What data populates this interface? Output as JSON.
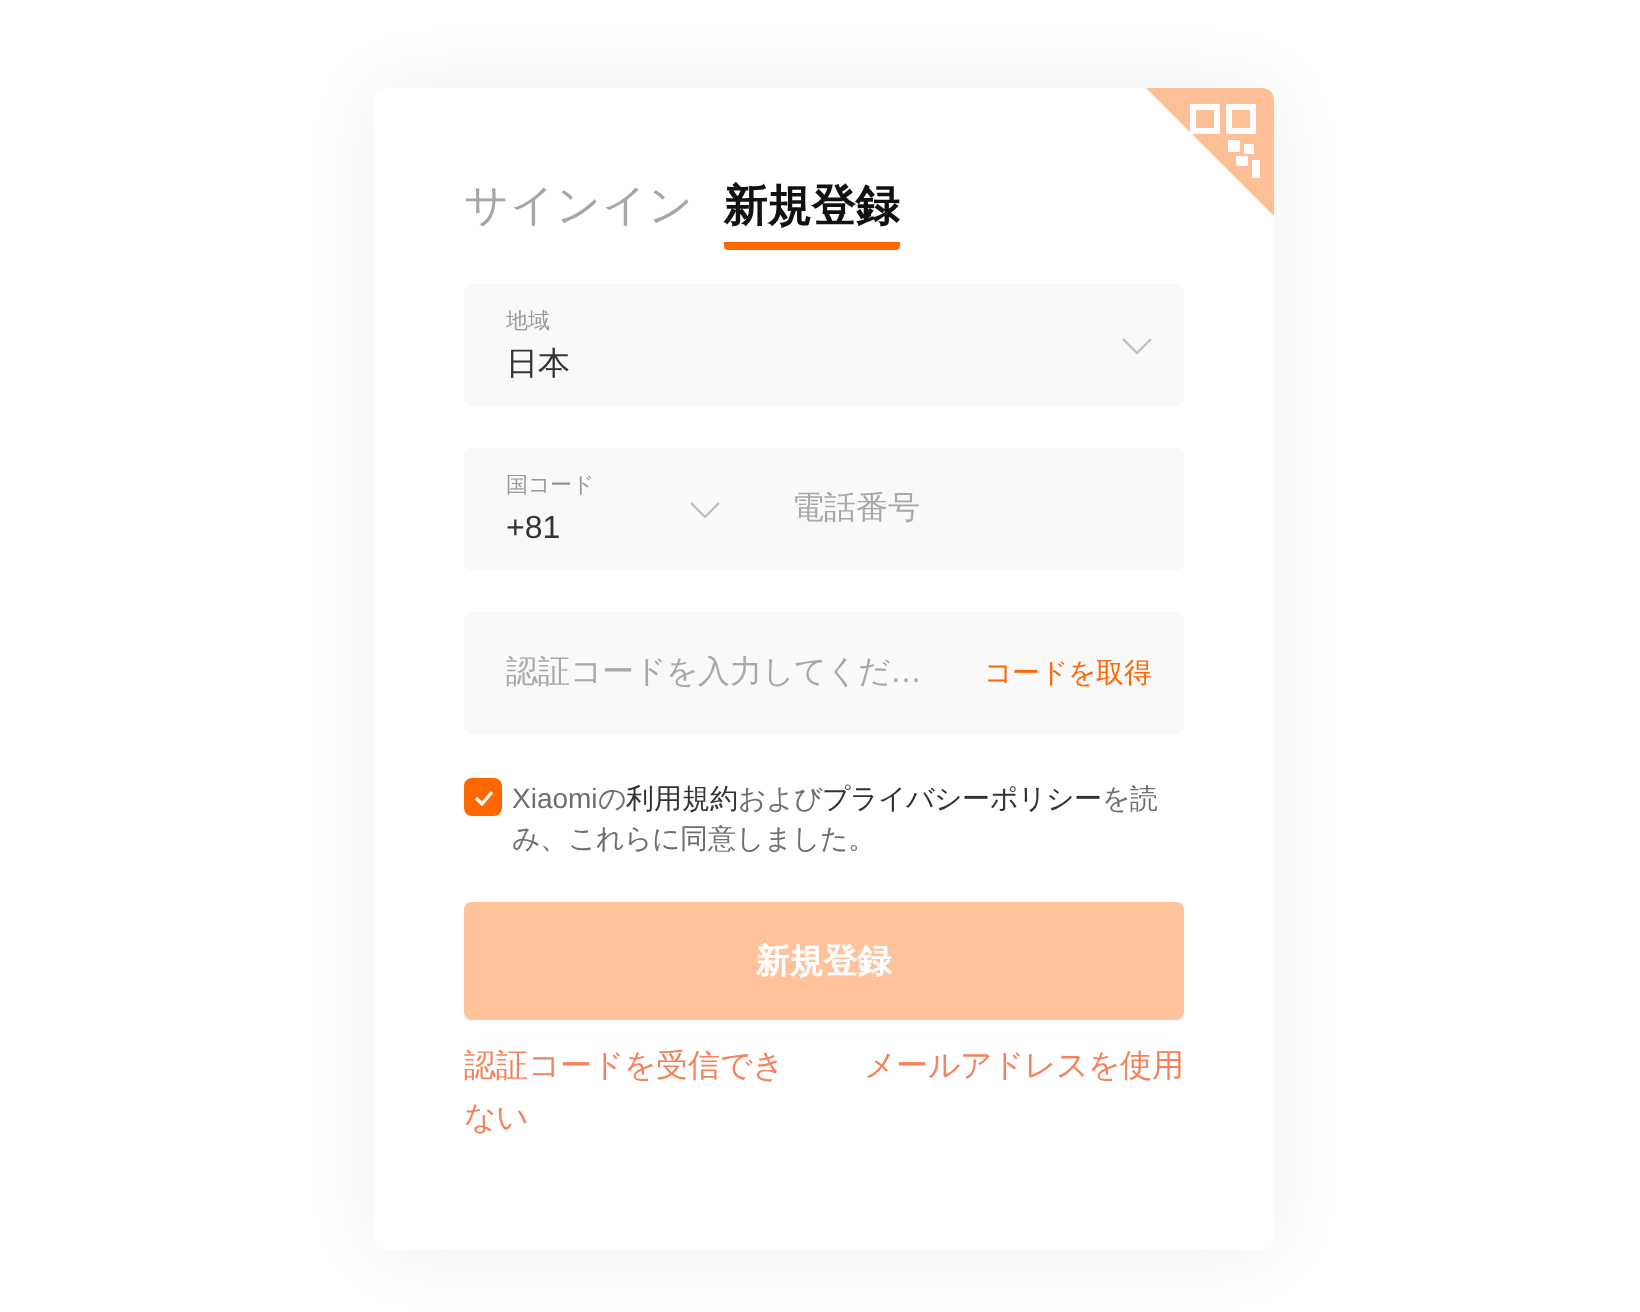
{
  "tabs": [
    {
      "label": "サインイン",
      "selected": false
    },
    {
      "label": "新規登録",
      "selected": true
    }
  ],
  "region_field": {
    "label": "地域",
    "value": "日本"
  },
  "phone_field": {
    "country_code_label": "国コード",
    "country_code": "+81",
    "placeholder": "電話番号"
  },
  "code_field": {
    "placeholder": "認証コードを入力してくだ…",
    "get_code_link": "コードを取得"
  },
  "agreement": {
    "checked": true,
    "parts": [
      {
        "kind": "text",
        "text": "Xiaomiの"
      },
      {
        "kind": "link",
        "text": "利用規約"
      },
      {
        "kind": "text",
        "text": "および"
      },
      {
        "kind": "link",
        "text": "プライバシーポリシー"
      },
      {
        "kind": "text",
        "text": "を読み、これらに同意しました。"
      }
    ]
  },
  "submit_button": {
    "label": "新規登録",
    "disabled": true
  },
  "footer_links": [
    "認証コードを受信できない",
    "メールアドレスを使用"
  ]
}
